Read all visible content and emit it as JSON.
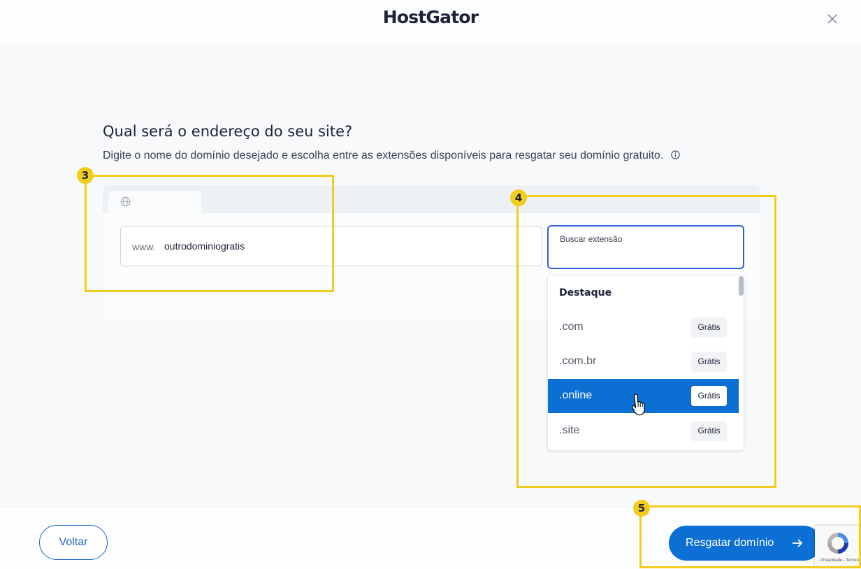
{
  "header": {
    "logo": "HostGator"
  },
  "main": {
    "title": "Qual será o endereço do seu site?",
    "subtitle": "Digite o nome do domínio desejado e escolha entre as extensões disponíveis para resgatar seu domínio gratuito."
  },
  "domain_input": {
    "prefix": "www.",
    "value": "outrodominiogratis"
  },
  "extension_search": {
    "label": "Buscar extensão"
  },
  "dropdown": {
    "heading": "Destaque",
    "items": [
      {
        "ext": ".com",
        "badge": "Grátis",
        "selected": false
      },
      {
        "ext": ".com.br",
        "badge": "Grátis",
        "selected": false
      },
      {
        "ext": ".online",
        "badge": "Grátis",
        "selected": true
      },
      {
        "ext": ".site",
        "badge": "Grátis",
        "selected": false
      }
    ]
  },
  "footer": {
    "back_label": "Voltar",
    "primary_label": "Resgatar domínio"
  },
  "recaptcha": {
    "text": "Privacidade - Termos"
  },
  "annotations": [
    {
      "number": "3"
    },
    {
      "number": "4"
    },
    {
      "number": "5"
    }
  ],
  "colors": {
    "primary": "#0b6fd4",
    "highlight": "#f2cd1e",
    "text": "#1d2237"
  },
  "icons": [
    "close-icon",
    "info-icon",
    "globe-icon",
    "arrow-right-icon",
    "hand-cursor-icon",
    "recaptcha-icon"
  ]
}
